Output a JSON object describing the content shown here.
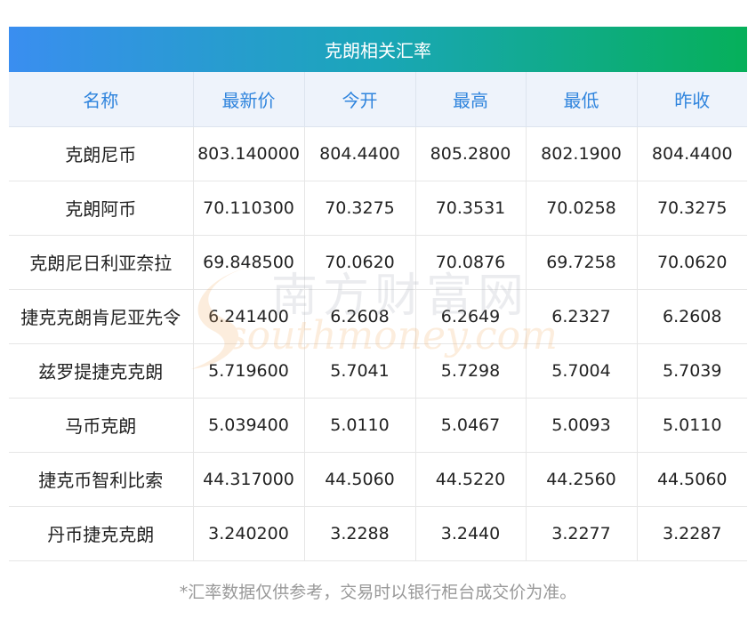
{
  "title": "克朗相关汇率",
  "columns": [
    "名称",
    "最新价",
    "今开",
    "最高",
    "最低",
    "昨收"
  ],
  "rows": [
    [
      "克朗尼币",
      "803.140000",
      "804.4400",
      "805.2800",
      "802.1900",
      "804.4400"
    ],
    [
      "克朗阿币",
      "70.110300",
      "70.3275",
      "70.3531",
      "70.0258",
      "70.3275"
    ],
    [
      "克朗尼日利亚奈拉",
      "69.848500",
      "70.0620",
      "70.0876",
      "69.7258",
      "70.0620"
    ],
    [
      "捷克克朗肯尼亚先令",
      "6.241400",
      "6.2608",
      "6.2649",
      "6.2327",
      "6.2608"
    ],
    [
      "兹罗提捷克克朗",
      "5.719600",
      "5.7041",
      "5.7298",
      "5.7004",
      "5.7039"
    ],
    [
      "马币克朗",
      "5.039400",
      "5.0110",
      "5.0467",
      "5.0093",
      "5.0110"
    ],
    [
      "捷克币智利比索",
      "44.317000",
      "44.5060",
      "44.5220",
      "44.2560",
      "44.5060"
    ],
    [
      "丹币捷克克朗",
      "3.240200",
      "3.2288",
      "3.2440",
      "3.2277",
      "3.2287"
    ]
  ],
  "footnote": "*汇率数据仅供参考，交易时以银行柜台成交价为准。",
  "watermark": {
    "cn": "南方财富网",
    "en": "southmoney.com"
  },
  "colors": {
    "header_text": "#2f84dd",
    "title_gradient": [
      "#3a8ef0",
      "#06b05a"
    ]
  }
}
